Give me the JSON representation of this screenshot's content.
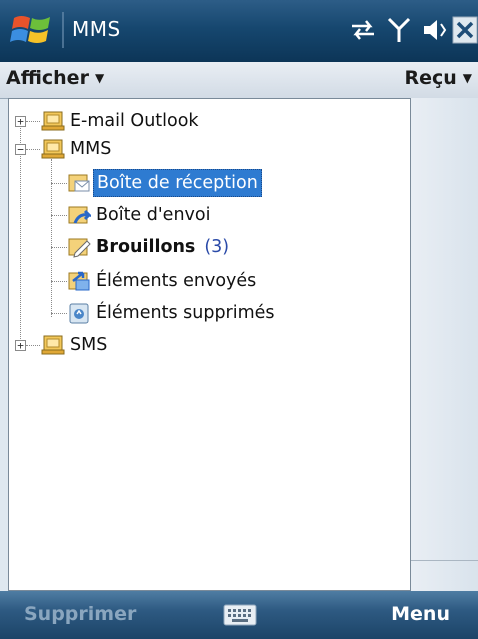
{
  "titlebar": {
    "title": "MMS"
  },
  "menubar": {
    "view_label": "Afficher",
    "received_label": "Reçu"
  },
  "tree": {
    "items": [
      {
        "label": "E-mail Outlook",
        "expander": "+"
      },
      {
        "label": "MMS",
        "expander": "−"
      },
      {
        "label": "Boîte de réception"
      },
      {
        "label": "Boîte d'envoi"
      },
      {
        "label": "Brouillons",
        "count": "(3)"
      },
      {
        "label": "Éléments envoyés"
      },
      {
        "label": "Éléments supprimés"
      },
      {
        "label": "SMS",
        "expander": "+"
      }
    ]
  },
  "softkeys": {
    "left_label": "Supprimer",
    "right_label": "Menu"
  },
  "colors": {
    "selection": "#2e7bd1",
    "titlebar": "#16476f",
    "count": "#2a4aa8"
  }
}
